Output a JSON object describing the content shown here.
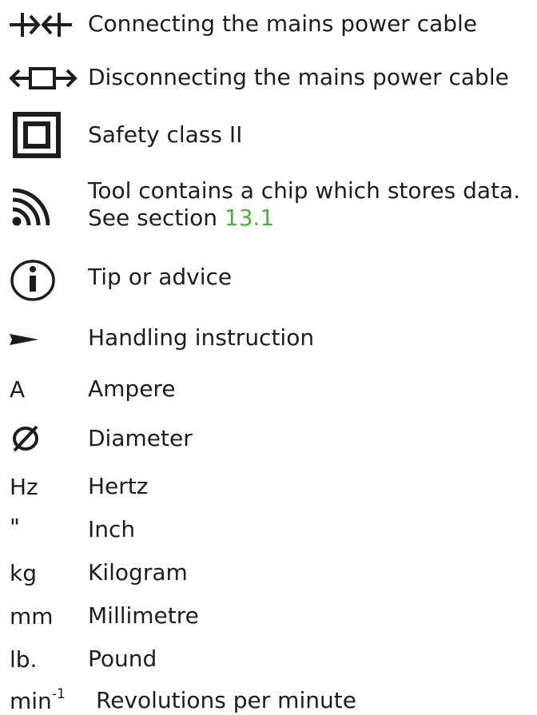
{
  "legend": {
    "items": [
      {
        "icon": "plug-connect-icon",
        "text": "Connecting the mains power cable"
      },
      {
        "icon": "plug-disconnect-icon",
        "text": "Disconnecting the mains power cable"
      },
      {
        "icon": "safety-class-2-icon",
        "text": "Safety class II"
      },
      {
        "icon": "rfid-chip-icon",
        "line1": "Tool contains a chip which stores data.",
        "line2_prefix": "See section ",
        "line2_link": "13.1"
      },
      {
        "icon": "info-icon",
        "text": "Tip or advice"
      },
      {
        "icon": "pointer-arrow-icon",
        "text": "Handling instruction"
      },
      {
        "symbol": "A",
        "text": "Ampere"
      },
      {
        "icon": "diameter-icon",
        "text": "Diameter"
      },
      {
        "symbol": "Hz",
        "text": "Hertz"
      },
      {
        "symbol": "\"",
        "text": "Inch"
      },
      {
        "symbol": "kg",
        "text": "Kilogram"
      },
      {
        "symbol": "mm",
        "text": "Millimetre"
      },
      {
        "symbol": "lb.",
        "text": "Pound"
      },
      {
        "symbol": "min",
        "symbol_sup": "-1",
        "text": "Revolutions per minute"
      }
    ]
  }
}
